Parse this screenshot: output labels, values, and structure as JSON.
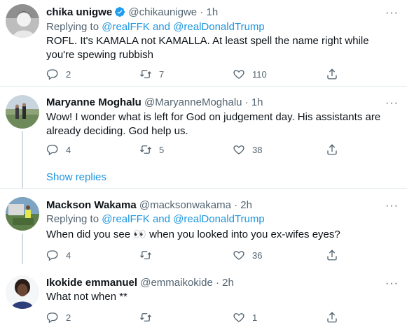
{
  "tweets": [
    {
      "name": "chika unigwe",
      "verified": true,
      "handle": "@chikaunigwe",
      "time": "1h",
      "replying_prefix": "Replying to",
      "mention1": "@realFFK",
      "and": "and",
      "mention2": "@realDonaldTrump",
      "text": "ROFL. It's KAMALA not KAMALLA. At least spell the name right while you're spewing rubbish",
      "replies": "2",
      "retweets": "7",
      "likes": "110"
    },
    {
      "name": "Maryanne Moghalu",
      "handle": "@MaryanneMoghalu",
      "time": "1h",
      "text": "Wow! I wonder what is left for God on judgement day.  His assistants are already deciding. God help us.",
      "replies": "4",
      "retweets": "5",
      "likes": "38"
    },
    {
      "name": "Mackson Wakama",
      "handle": "@macksonwakama",
      "time": "2h",
      "replying_prefix": "Replying to",
      "mention1": "@realFFK",
      "and": "and",
      "mention2": "@realDonaldTrump",
      "text": "When did you see 👀 when you looked into you ex-wifes eyes?",
      "replies": "4",
      "retweets": "",
      "likes": "36"
    },
    {
      "name": "Ikokide emmanuel",
      "handle": "@emmaikokide",
      "time": "2h",
      "text": "What not when **",
      "replies": "2",
      "retweets": "",
      "likes": "1"
    }
  ],
  "show_replies": "Show replies",
  "separator": "·",
  "colors": {
    "link": "#1b95e0",
    "muted": "#536471",
    "verified": "#1d9bf0",
    "divider": "#e6ecf0"
  }
}
